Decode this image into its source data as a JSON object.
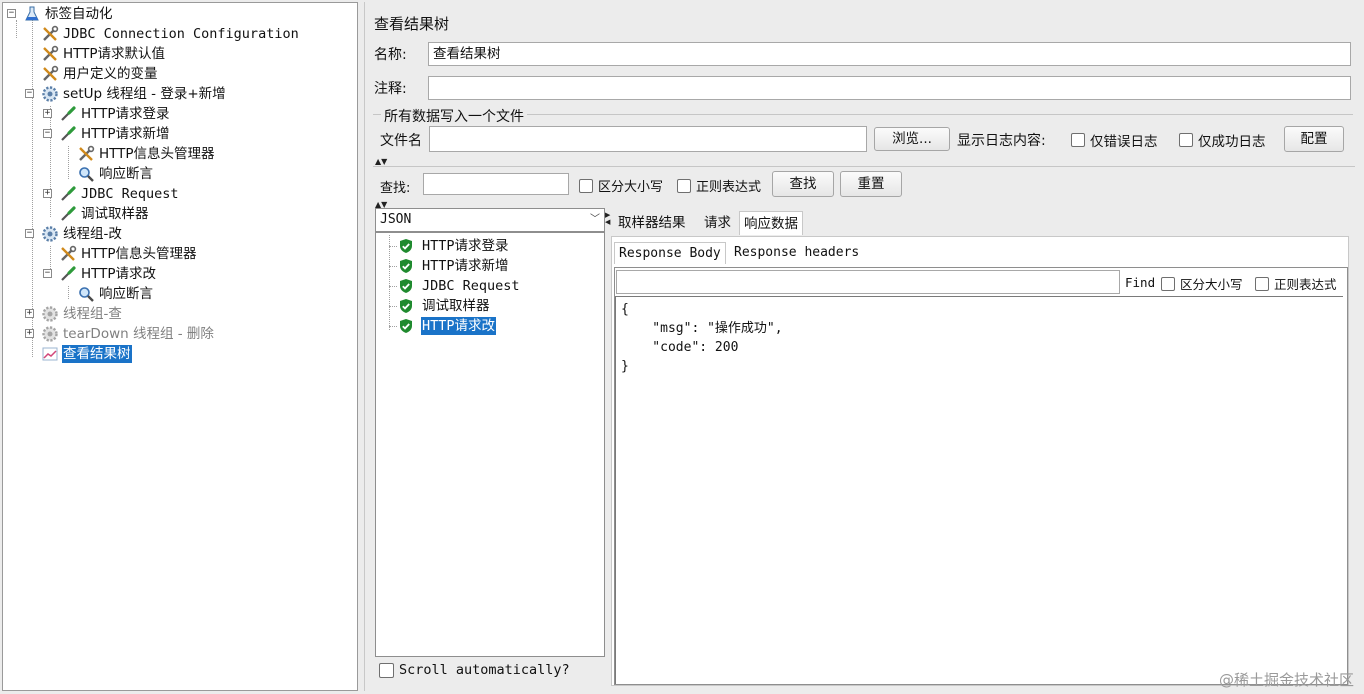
{
  "tree": {
    "items": [
      {
        "label": "标签自动化",
        "icon": "flask-icon",
        "level": 0,
        "expander": "minus"
      },
      {
        "label": "JDBC Connection Configuration",
        "icon": "config-wrench-icon",
        "level": 1,
        "mono": true
      },
      {
        "label": "HTTP请求默认值",
        "icon": "config-wrench-icon",
        "level": 1
      },
      {
        "label": "用户定义的变量",
        "icon": "config-wrench-icon",
        "level": 1
      },
      {
        "label": "setUp 线程组 - 登录+新增",
        "icon": "gear-icon",
        "level": 1,
        "expander": "minus"
      },
      {
        "label": "HTTP请求登录",
        "icon": "sampler-pipette-icon",
        "level": 2,
        "expander": "plus"
      },
      {
        "label": "HTTP请求新增",
        "icon": "sampler-pipette-icon",
        "level": 2,
        "expander": "minus"
      },
      {
        "label": "HTTP信息头管理器",
        "icon": "config-wrench-icon",
        "level": 3
      },
      {
        "label": "响应断言",
        "icon": "magnifier-icon",
        "level": 3
      },
      {
        "label": "JDBC Request",
        "icon": "sampler-pipette-icon",
        "level": 2,
        "expander": "plus",
        "mono": true
      },
      {
        "label": "调试取样器",
        "icon": "sampler-pipette-icon",
        "level": 2
      },
      {
        "label": "线程组-改",
        "icon": "gear-icon",
        "level": 1,
        "expander": "minus"
      },
      {
        "label": "HTTP信息头管理器",
        "icon": "config-wrench-icon",
        "level": 2
      },
      {
        "label": "HTTP请求改",
        "icon": "sampler-pipette-icon",
        "level": 2,
        "expander": "minus"
      },
      {
        "label": "响应断言",
        "icon": "magnifier-icon",
        "level": 3
      },
      {
        "label": "线程组-查",
        "icon": "gear-disabled-icon",
        "level": 1,
        "expander": "plus",
        "disabled": true
      },
      {
        "label": "tearDown 线程组 - 删除",
        "icon": "gear-disabled-icon",
        "level": 1,
        "expander": "plus",
        "disabled": true
      },
      {
        "label": "查看结果树",
        "icon": "chart-icon",
        "level": 1,
        "selected": true
      }
    ]
  },
  "panel": {
    "title": "查看结果树",
    "name_label": "名称:",
    "name_value": "查看结果树",
    "comment_label": "注释:",
    "comment_value": "",
    "file_group_title": "所有数据写入一个文件",
    "filename_label": "文件名",
    "filename_value": "",
    "browse_button": "浏览...",
    "log_display_label": "显示日志内容:",
    "errors_only_label": "仅错误日志",
    "success_only_label": "仅成功日志",
    "configure_button": "配置"
  },
  "search": {
    "label": "查找:",
    "value": "",
    "case_sensitive_label": "区分大小写",
    "regex_label": "正则表达式",
    "find_button": "查找",
    "reset_button": "重置"
  },
  "results": {
    "renderer": "JSON",
    "items": [
      {
        "label": "HTTP请求登录",
        "status": "ok"
      },
      {
        "label": "HTTP请求新增",
        "status": "ok"
      },
      {
        "label": "JDBC Request",
        "status": "ok"
      },
      {
        "label": "调试取样器",
        "status": "ok"
      },
      {
        "label": "HTTP请求改",
        "status": "ok",
        "selected": true
      }
    ],
    "scroll_auto_label": "Scroll automatically?"
  },
  "detail": {
    "tabs": [
      "取样器结果",
      "请求",
      "响应数据"
    ],
    "active_tab": 2,
    "subtabs": [
      "Response Body",
      "Response headers"
    ],
    "active_subtab": 0,
    "find_value": "",
    "find_label": "Find",
    "case_sensitive_label": "区分大小写",
    "regex_label": "正则表达式",
    "body_lines": [
      "{",
      "    \"msg\": \"操作成功\",",
      "    \"code\": 200",
      "}"
    ]
  },
  "watermark": "@稀土掘金技术社区",
  "colors": {
    "selection": "#1a73c8",
    "ok_shield": "#1f8a2e"
  }
}
